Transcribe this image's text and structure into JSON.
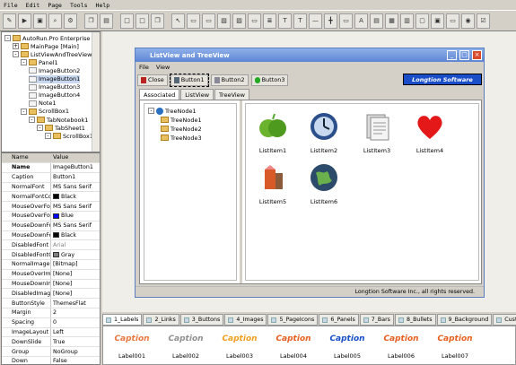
{
  "menu": [
    "File",
    "Edit",
    "Page",
    "Tools",
    "Help"
  ],
  "tree": [
    {
      "label": "AutoRun.Pro Enterprise II Dem",
      "indent": 0,
      "exp": "-"
    },
    {
      "label": "MainPage [Main]",
      "indent": 1,
      "exp": "+"
    },
    {
      "label": "ListViewAndTreeView",
      "indent": 1,
      "exp": "-"
    },
    {
      "label": "Panel1",
      "indent": 2,
      "exp": "-"
    },
    {
      "label": "ImageButton2",
      "indent": 3,
      "exp": ""
    },
    {
      "label": "ImageButton1",
      "indent": 3,
      "exp": ""
    },
    {
      "label": "ImageButton3",
      "indent": 3,
      "exp": ""
    },
    {
      "label": "ImageButton4",
      "indent": 3,
      "exp": ""
    },
    {
      "label": "Note1",
      "indent": 3,
      "exp": ""
    },
    {
      "label": "ScrollBox1",
      "indent": 2,
      "exp": "-"
    },
    {
      "label": "TabNotebook1",
      "indent": 3,
      "exp": "-"
    },
    {
      "label": "TabSheet1",
      "indent": 4,
      "exp": "-"
    },
    {
      "label": "ScrollBox1",
      "indent": 5,
      "exp": "-"
    }
  ],
  "props_header": {
    "name": "Name",
    "value": "Value"
  },
  "props": [
    {
      "name": "Name",
      "value": "ImageButton1",
      "bold": true
    },
    {
      "name": "Caption",
      "value": "Button1"
    },
    {
      "name": "NormalFont",
      "value": "MS Sans Serif"
    },
    {
      "name": "NormalFontColor",
      "value": "Black",
      "swatch": "#000000"
    },
    {
      "name": "MouseOverFont",
      "value": "MS Sans Serif"
    },
    {
      "name": "MouseOverFontColor",
      "value": "Blue",
      "swatch": "#0000ff"
    },
    {
      "name": "MouseDownFont",
      "value": "MS Sans Serif"
    },
    {
      "name": "MouseDownFontColor",
      "value": "Black",
      "swatch": "#000000"
    },
    {
      "name": "DisabledFont",
      "value": "Arial"
    },
    {
      "name": "DisabledFontColor",
      "value": "Gray",
      "swatch": "#808080"
    },
    {
      "name": "NormalImage",
      "value": "[Bitmap]"
    },
    {
      "name": "MouseOverImage",
      "value": "[None]"
    },
    {
      "name": "MouseDownImage",
      "value": "[None]"
    },
    {
      "name": "DisabledImage",
      "value": "[None]"
    },
    {
      "name": "ButtonStyle",
      "value": "ThemesFlat"
    },
    {
      "name": "Margin",
      "value": "2"
    },
    {
      "name": "Spacing",
      "value": "0"
    },
    {
      "name": "ImageLayout",
      "value": "Left"
    },
    {
      "name": "DownSlide",
      "value": "True"
    },
    {
      "name": "Group",
      "value": "NoGroup"
    },
    {
      "name": "Down",
      "value": "False"
    }
  ],
  "window": {
    "title": "ListView and TreeView",
    "menu": [
      "File",
      "View"
    ],
    "buttons": [
      "Close",
      "Button1",
      "Button2",
      "Button3"
    ],
    "brand": "Longtion Software",
    "tabs": [
      "Associated",
      "ListView",
      "TreeView"
    ],
    "tree": [
      {
        "label": "TreeNode1",
        "indent": 0
      },
      {
        "label": "TreeNode1",
        "indent": 1
      },
      {
        "label": "TreeNode2",
        "indent": 1
      },
      {
        "label": "TreeNode3",
        "indent": 1
      }
    ],
    "items": [
      "ListItem1",
      "ListItem2",
      "ListItem3",
      "ListItem4",
      "ListItem5",
      "ListItem6"
    ],
    "status": "Longtion Software Inc., all rights reserved."
  },
  "bottom_tabs": [
    "1_Labels",
    "2_Links",
    "3_Buttons",
    "4_Images",
    "5_PageIcons",
    "6_Panels",
    "7_Bars",
    "8_Bullets",
    "9_Background",
    "Custom"
  ],
  "captions": [
    {
      "text": "Caption",
      "label": "Label001",
      "color": "#e87840"
    },
    {
      "text": "Caption",
      "label": "Label002",
      "color": "#909090"
    },
    {
      "text": "Caption",
      "label": "Label003",
      "color": "#f0a020"
    },
    {
      "text": "Caption",
      "label": "Label004",
      "color": "#e86020"
    },
    {
      "text": "Caption",
      "label": "Label005",
      "color": "#1850c8"
    },
    {
      "text": "Caption",
      "label": "Label006",
      "color": "#e86020"
    },
    {
      "text": "Caption",
      "label": "Label007",
      "color": "#e86020"
    }
  ]
}
